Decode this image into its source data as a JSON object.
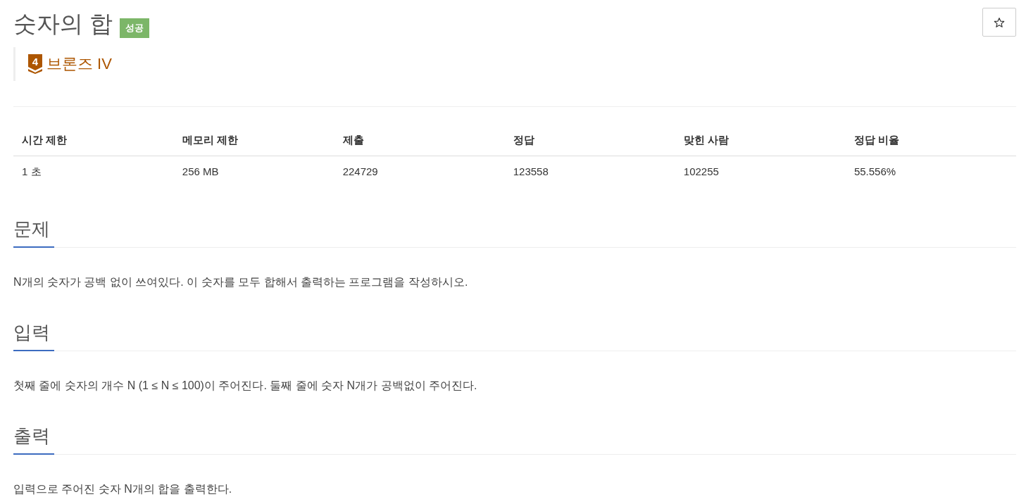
{
  "problem": {
    "title": "숫자의 합",
    "result_badge": "성공",
    "starred": false,
    "tier": {
      "icon_number": "4",
      "label": "브론즈 IV"
    }
  },
  "stats_table": {
    "columns": [
      "시간 제한",
      "메모리 제한",
      "제출",
      "정답",
      "맞힌 사람",
      "정답 비율"
    ],
    "rows": [
      [
        "1 초",
        "256 MB",
        "224729",
        "123558",
        "102255",
        "55.556%"
      ]
    ]
  },
  "sections": [
    {
      "heading": "문제",
      "text": "N개의 숫자가 공백 없이 쓰여있다. 이 숫자를 모두 합해서 출력하는 프로그램을 작성하시오."
    },
    {
      "heading": "입력",
      "text": "첫째 줄에 숫자의 개수 N (1 ≤ N ≤ 100)이 주어진다. 둘째 줄에 숫자 N개가 공백없이 주어진다."
    },
    {
      "heading": "출력",
      "text": "입력으로 주어진 숫자 N개의 합을 출력한다."
    }
  ]
}
